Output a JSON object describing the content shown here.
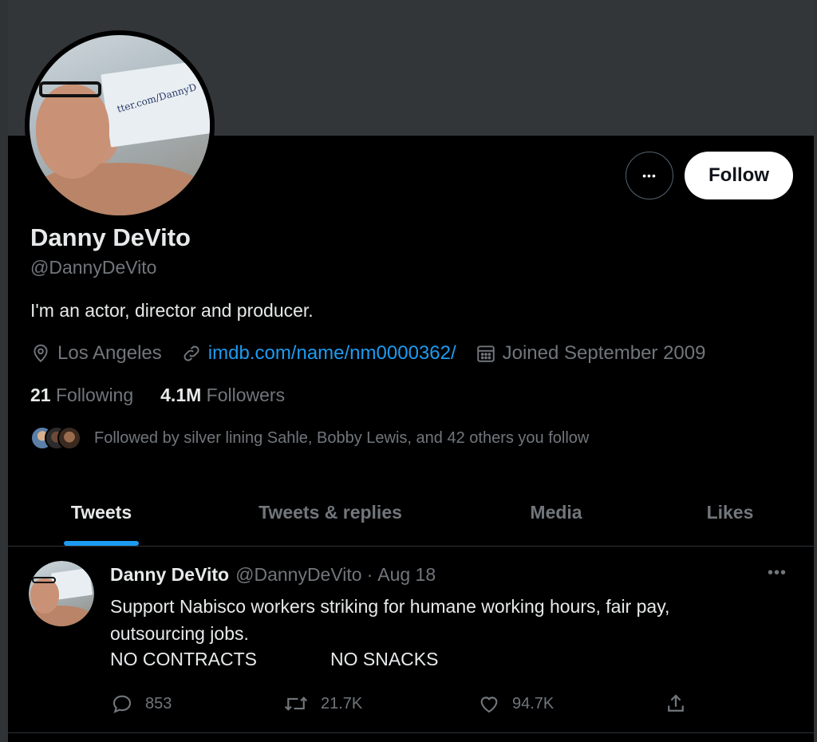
{
  "profile": {
    "name": "Danny DeVito",
    "handle": "@DannyDeVito",
    "bio": "I'm an actor, director and producer.",
    "location": "Los Angeles",
    "link": "imdb.com/name/nm0000362/",
    "joined": "Joined September 2009",
    "following_count": "21",
    "following_label": "Following",
    "followers_count": "4.1M",
    "followers_label": "Followers",
    "followed_by": "Followed by silver lining Sahle, Bobby Lewis, and 42 others you follow",
    "avatar_card_text": "tter.com/DannyD"
  },
  "actions": {
    "follow_label": "Follow",
    "more_label": "•••"
  },
  "tabs": [
    {
      "label": "Tweets",
      "active": true
    },
    {
      "label": "Tweets & replies",
      "active": false
    },
    {
      "label": "Media",
      "active": false
    },
    {
      "label": "Likes",
      "active": false
    }
  ],
  "tweet": {
    "name": "Danny DeVito",
    "handle": "@DannyDeVito",
    "separator": "·",
    "date": "Aug 18",
    "line1": "Support Nabisco workers striking for humane working hours, fair pay,",
    "line2": "outsourcing jobs.",
    "caps_left": "NO CONTRACTS",
    "caps_right": "NO SNACKS",
    "replies": "853",
    "retweets": "21.7K",
    "likes": "94.7K",
    "more_label": "•••"
  },
  "colors": {
    "accent": "#1d9bf0",
    "muted": "#71767b",
    "text": "#e7e9ea",
    "background": "#000000",
    "banner": "#333639"
  },
  "icons": [
    "location-icon",
    "link-icon",
    "calendar-icon",
    "reply-icon",
    "retweet-icon",
    "like-icon",
    "share-icon"
  ]
}
